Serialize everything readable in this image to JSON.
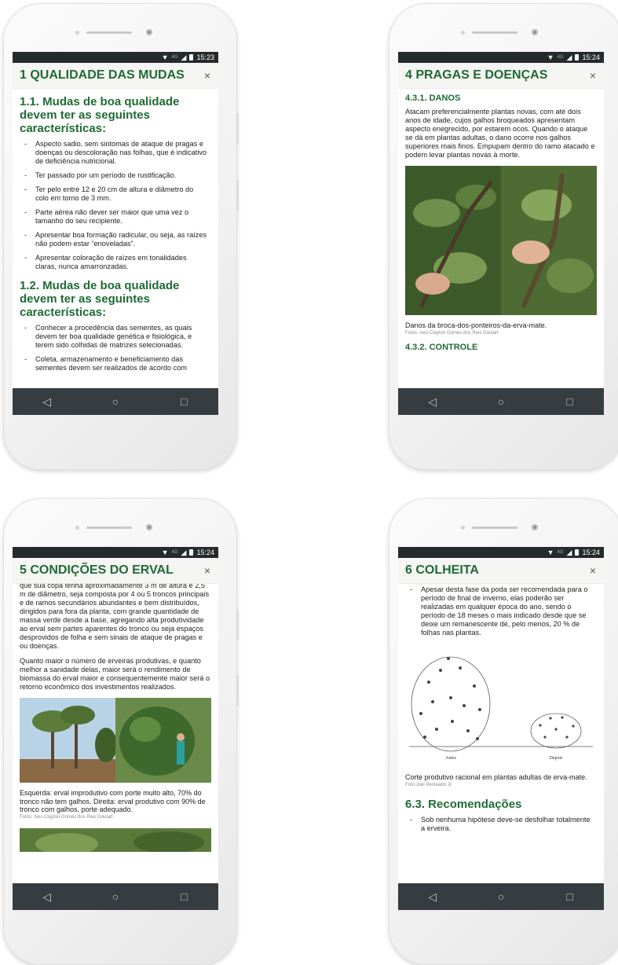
{
  "status": {
    "time1": "15:23",
    "time2": "15:24",
    "signal": "4G"
  },
  "nav": {
    "back": "◁",
    "home": "○",
    "recent": "□"
  },
  "close_glyph": "×",
  "screen1": {
    "title": "1 QUALIDADE DAS MUDAS",
    "section1_heading": "1.1. Mudas de boa qualidade devem ter as seguintes características:",
    "section1_items": [
      "Aspecto sadio, sem sintomas de ataque de pragas e doenças ou descoloração nas folhas, que é indicativo de deficiência nutricional.",
      "Ter passado por um período de rustificação.",
      "Ter pelo entre 12 e 20 cm de altura e diâmetro do colo em torno de 3 mm.",
      "Parte aérea não dever ser maior que uma vez o tamanho do seu recipiente.",
      "Apresentar boa formação radicular, ou seja, as raízes não podem estar “enoveladas”.",
      "Apresentar coloração de raízes em tonalidades claras, nunca amarronzadas."
    ],
    "section2_heading": "1.2. Mudas de boa qualidade devem ter as seguintes características:",
    "section2_items": [
      "Conhecer a procedência das sementes, as quais devem ter boa qualidade genética e fisiológica, e terem sido colhidas de matrizes selecionadas.",
      "Coleta, armazenamento e beneficiamento das sementes devem ser realizados de acordo com"
    ]
  },
  "screen2": {
    "title": "4 PRAGAS E DOENÇAS",
    "sub1": "4.3.1. DANOS",
    "para": "Atacam preferencialmente plantas novas, com até dois anos de idade, cujos galhos broqueados apresentam aspecto enegrecido, por estarem ocos. Quando o ataque se dá em plantas adultas, o dano ocorre nos galhos superiores mais finos. Empupam dentro do ramo atacado e podem levar plantas novas à morte.",
    "caption": "Danos da broca-dos-ponteiros-da-erva-mate.",
    "credit": "Fotos: Ives Clayton Gomes dos Reis Goulart",
    "sub2": "4.3.2. CONTROLE"
  },
  "screen3": {
    "title": "5 CONDIÇÕES DO ERVAL",
    "para1": "que sua copa tenha aproximadamente 3 m de altura e 2,5 m de diâmetro, seja composta por 4 ou 5 troncos principais e de ramos secundários abundantes e bem distribuídos, dirigidos para fora da planta, com grande quantidade de massa verde desde a base, agregando alta produtividade ao erval sem partes aparentes do tronco ou seja espaços desprovidos de folha e sem sinais de ataque de pragas e ou doenças.",
    "para2": "Quanto maior o número de erveiras produtivas, e quanto melhor a sanidade delas, maior será o rendimento de biomassa do erval maior e consequentemente maior será o retorno econômico dos investimentos realizados.",
    "caption": "Esquerda: erval improdutivo com porte muito alto, 70% do tronco não tem galhos. Direita: erval produtivo com 90% de tronco com galhos, porte adequado.",
    "credit": "Fotos: Ives Clayton Gomes dos Reis Goulart"
  },
  "screen4": {
    "title": "6 COLHEITA",
    "item1": "Apesar desta fase da poda ser recomendada para o período de final de inverno, elas poderão ser realizadas em qualquer época do ano, sendo o período de 18 meses o mais indicado desde que se deixe um remanescente de, pelo menos, 20 % de folhas nas plantas.",
    "label_before": "Antes",
    "label_after": "Depois",
    "caption": "Corte produtivo racional em plantas adultas de erva-mate.",
    "credit": "Foto:Joel Penteado Jr",
    "section_heading": "6.3. Recomendações",
    "item2": "Sob nenhuma hipótese deve-se desfolhar totalmente a erveira."
  }
}
